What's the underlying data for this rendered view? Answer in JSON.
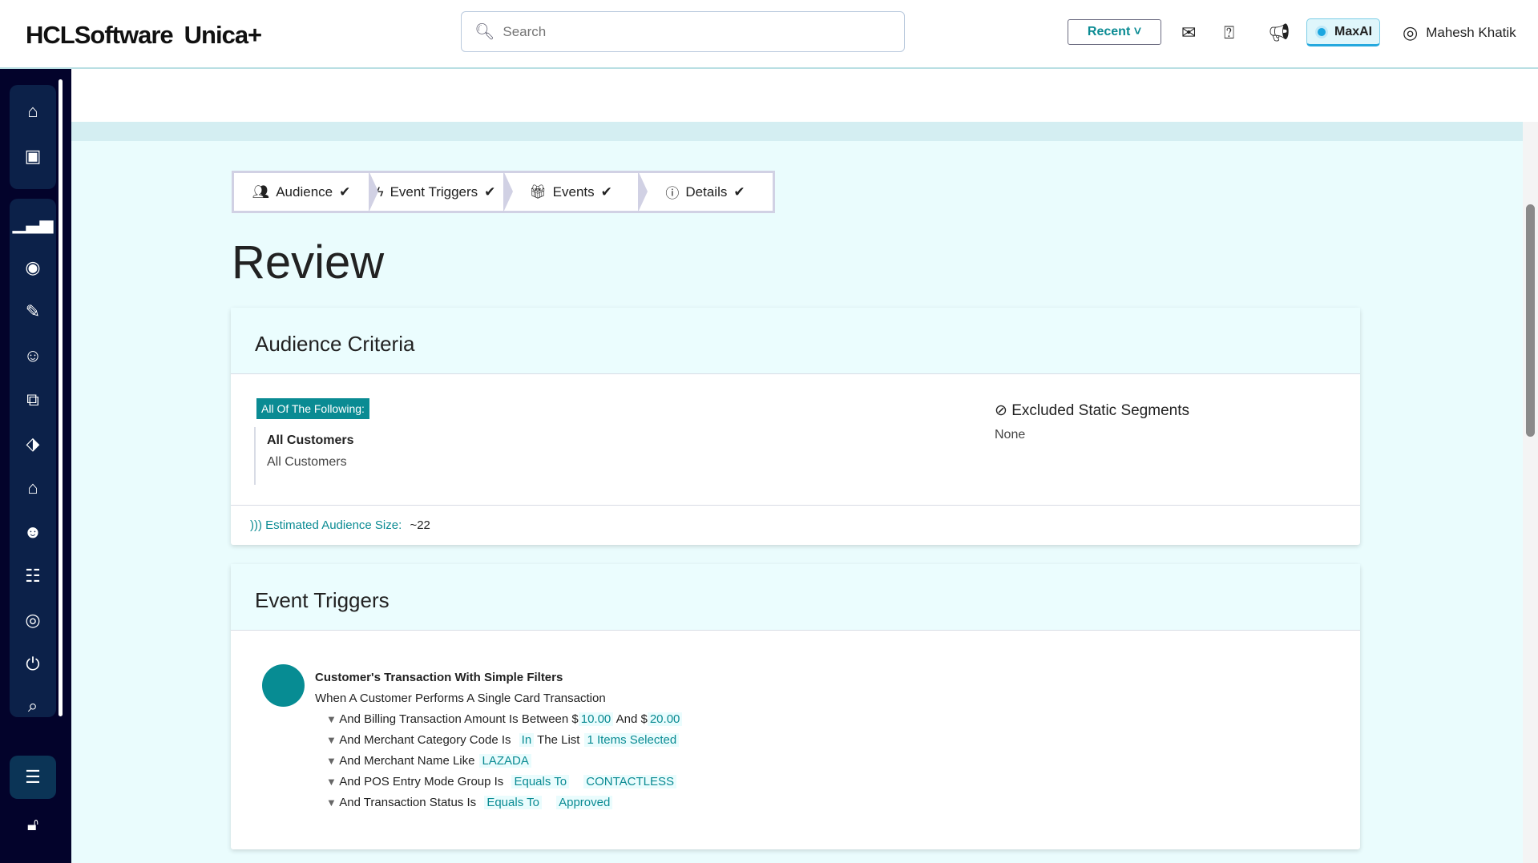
{
  "header": {
    "logo": "HCLSoftware",
    "product": "Unica+",
    "search_placeholder": "Search",
    "recent": "Recent",
    "maxai": "MaxAI",
    "user": "Mahesh Khatik"
  },
  "stepper": [
    {
      "label": "Audience",
      "icon": "users-icon"
    },
    {
      "label": "Event Triggers",
      "icon": "bolt-icon"
    },
    {
      "label": "Events",
      "icon": "gift-icon"
    },
    {
      "label": "Details",
      "icon": "info-icon"
    }
  ],
  "page_title": "Review",
  "audience": {
    "title": "Audience Criteria",
    "tag": "All Of The Following:",
    "item_title": "All Customers",
    "item_sub": "All Customers",
    "excluded_title": "Excluded Static Segments",
    "excluded_value": "None",
    "est_label": "Estimated Audience Size:",
    "est_value": "~22"
  },
  "triggers": {
    "title": "Event Triggers",
    "name": "Customer's Transaction With Simple Filters",
    "desc": "When A Customer Performs A Single Card Transaction",
    "filters": [
      {
        "text": "And Billing Transaction Amount Is Between",
        "a": "$",
        "v1": "10.00",
        "mid": "And",
        "b": "$",
        "v2": "20.00"
      },
      {
        "text": "And Merchant Category Code Is",
        "v1": "In",
        "mid": "The List",
        "v2": "1 Items Selected"
      },
      {
        "text": "And Merchant Name Like",
        "v1": "LAZADA"
      },
      {
        "text": "And POS Entry Mode Group Is",
        "v1": "Equals To",
        "v2": "CONTACTLESS"
      },
      {
        "text": "And Transaction Status Is",
        "v1": "Equals To",
        "v2": "Approved"
      }
    ]
  }
}
